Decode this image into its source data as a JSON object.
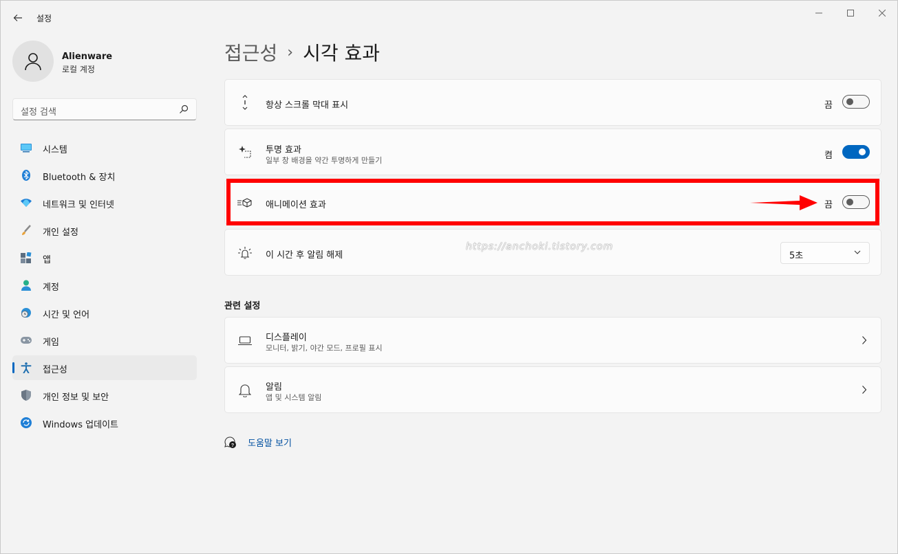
{
  "window": {
    "title": "설정",
    "back_icon": "arrow-left-icon"
  },
  "profile": {
    "name": "Alienware",
    "account_type": "로컬 계정"
  },
  "search": {
    "placeholder": "설정 검색"
  },
  "sidebar": {
    "items": [
      {
        "label": "시스템",
        "icon": "monitor-icon"
      },
      {
        "label": "Bluetooth & 장치",
        "icon": "bluetooth-icon"
      },
      {
        "label": "네트워크 및 인터넷",
        "icon": "wifi-icon"
      },
      {
        "label": "개인 설정",
        "icon": "brush-icon"
      },
      {
        "label": "앱",
        "icon": "apps-icon"
      },
      {
        "label": "계정",
        "icon": "person-icon"
      },
      {
        "label": "시간 및 언어",
        "icon": "globe-clock-icon"
      },
      {
        "label": "게임",
        "icon": "gamepad-icon"
      },
      {
        "label": "접근성",
        "icon": "accessibility-icon",
        "active": true
      },
      {
        "label": "개인 정보 및 보안",
        "icon": "shield-icon"
      },
      {
        "label": "Windows 업데이트",
        "icon": "update-icon"
      }
    ]
  },
  "breadcrumb": {
    "parent": "접근성",
    "separator": "›",
    "current": "시각 효과"
  },
  "settings": {
    "scrollbars": {
      "title": "항상 스크롤 막대 표시",
      "state_label": "끔",
      "on": false
    },
    "transparency": {
      "title": "투명 효과",
      "subtitle": "일부 창 배경을 약간 투명하게 만들기",
      "state_label": "켬",
      "on": true
    },
    "animation": {
      "title": "애니메이션 효과",
      "state_label": "끔",
      "on": false
    },
    "notifications": {
      "title": "이 시간 후 알림 해제",
      "value": "5초"
    }
  },
  "related": {
    "title": "관련 설정",
    "display": {
      "title": "디스플레이",
      "subtitle": "모니터, 밝기, 야간 모드, 프로필 표시"
    },
    "notifications": {
      "title": "알림",
      "subtitle": "앱 및 시스템 알림"
    }
  },
  "help": {
    "label": "도움말 보기"
  },
  "watermark": "https://anchoki.tistory.com",
  "colors": {
    "accent": "#0067c0",
    "highlight": "#ff0000"
  }
}
